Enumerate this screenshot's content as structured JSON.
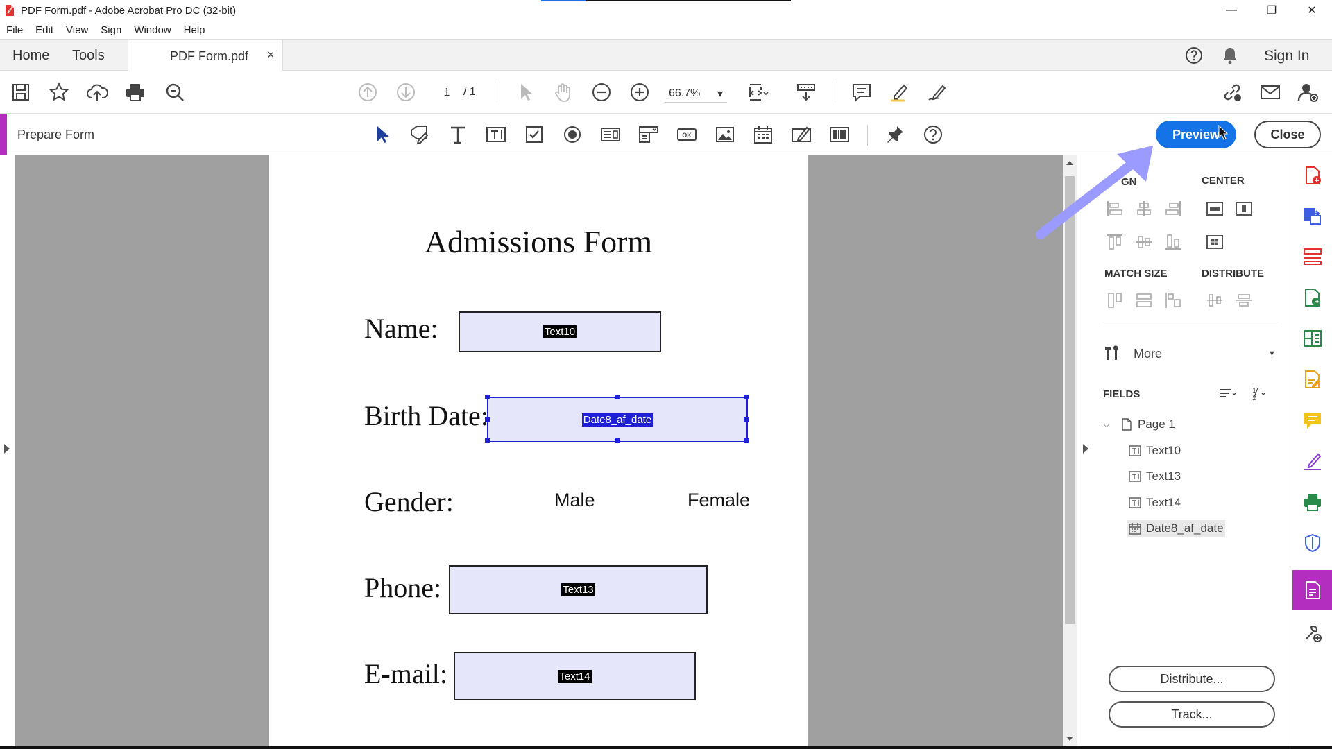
{
  "window": {
    "title": "PDF Form.pdf - Adobe Acrobat Pro DC (32-bit)",
    "load_progress": 0.18,
    "minimize": "—",
    "restore": "❐",
    "close": "✕"
  },
  "menu": [
    "File",
    "Edit",
    "View",
    "Sign",
    "Window",
    "Help"
  ],
  "tabs": {
    "home": "Home",
    "tools": "Tools",
    "document": "PDF Form.pdf",
    "document_close": "×",
    "sign_in": "Sign In"
  },
  "toolbar": {
    "page_current": "1",
    "page_total": "/ 1",
    "zoom": "66.7%",
    "zoom_caret": "▾"
  },
  "prepare": {
    "title": "Prepare Form",
    "preview": "Preview",
    "close": "Close"
  },
  "document": {
    "title": "Admissions Form",
    "labels": {
      "name": "Name:",
      "birth_date": "Birth Date:",
      "gender": "Gender:",
      "phone": "Phone:",
      "email": "E-mail:"
    },
    "fields": {
      "name": "Text10",
      "birth_date": "Date8_af_date",
      "phone": "Text13",
      "email": "Text14"
    },
    "gender_options": [
      "Male",
      "Female"
    ]
  },
  "panel": {
    "align_heading": "GN",
    "center_heading": "CENTER",
    "match_size_heading": "MATCH SIZE",
    "distribute_heading": "DISTRIBUTE",
    "more": "More",
    "fields_heading": "FIELDS",
    "tree": {
      "page": "Page 1",
      "items": [
        "Text10",
        "Text13",
        "Text14",
        "Date8_af_date"
      ]
    },
    "distribute_btn": "Distribute...",
    "track_btn": "Track..."
  },
  "colors": {
    "accent": "#b32dbe",
    "preview_blue": "#1473e6",
    "field_fill": "#e6e6fa",
    "selection_blue": "#1f1fd6",
    "annotation_arrow": "#9b9bff"
  }
}
